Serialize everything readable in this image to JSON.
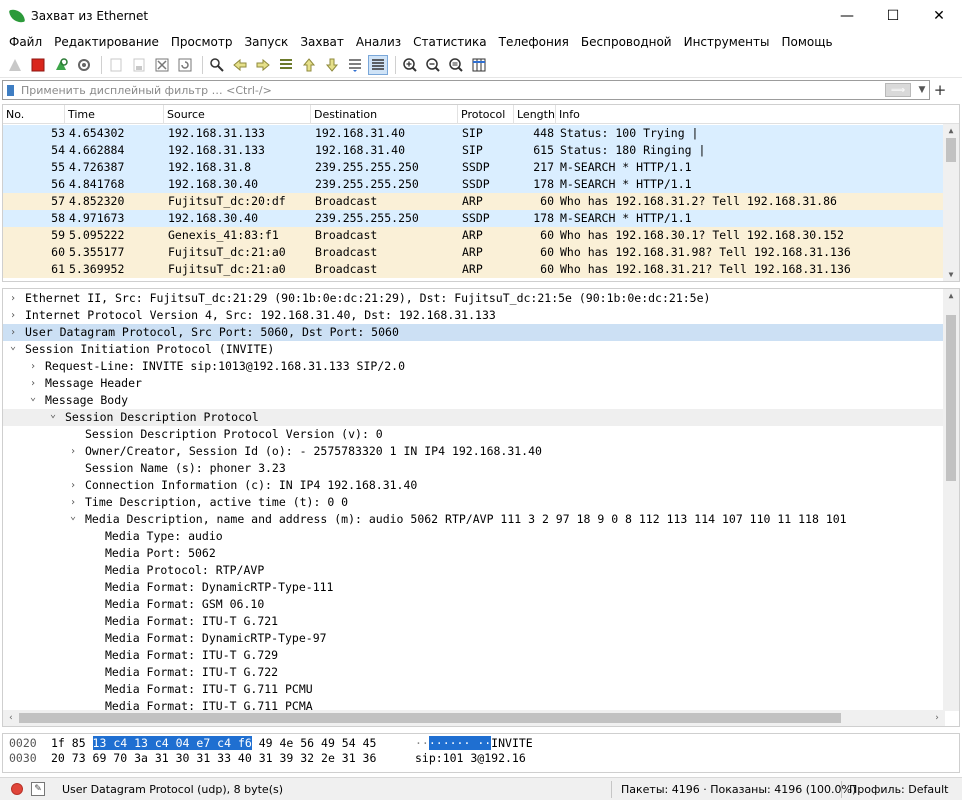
{
  "window": {
    "title": "Захват из Ethernet",
    "minimize": "—",
    "maximize": "☐",
    "close": "✕"
  },
  "menu": [
    "Файл",
    "Редактирование",
    "Просмотр",
    "Запуск",
    "Захват",
    "Анализ",
    "Статистика",
    "Телефония",
    "Беспроводной",
    "Инструменты",
    "Помощь"
  ],
  "filter": {
    "placeholder": "Применить дисплейный фильтр … <Ctrl-/>",
    "value": "",
    "apply": "⟹",
    "dropdown": "▼",
    "add": "+"
  },
  "packet_list": {
    "columns": [
      "No.",
      "Time",
      "Source",
      "Destination",
      "Protocol",
      "Length",
      "Info"
    ],
    "rows": [
      {
        "no": "53",
        "time": "4.654302",
        "src": "192.168.31.133",
        "dst": "192.168.31.40",
        "proto": "SIP",
        "len": "448",
        "info": "Status: 100 Trying |",
        "color": "udp"
      },
      {
        "no": "54",
        "time": "4.662884",
        "src": "192.168.31.133",
        "dst": "192.168.31.40",
        "proto": "SIP",
        "len": "615",
        "info": "Status: 180 Ringing |",
        "color": "udp"
      },
      {
        "no": "55",
        "time": "4.726387",
        "src": "192.168.31.8",
        "dst": "239.255.255.250",
        "proto": "SSDP",
        "len": "217",
        "info": "M-SEARCH * HTTP/1.1",
        "color": "udp"
      },
      {
        "no": "56",
        "time": "4.841768",
        "src": "192.168.30.40",
        "dst": "239.255.255.250",
        "proto": "SSDP",
        "len": "178",
        "info": "M-SEARCH * HTTP/1.1",
        "color": "udp"
      },
      {
        "no": "57",
        "time": "4.852320",
        "src": "FujitsuT_dc:20:df",
        "dst": "Broadcast",
        "proto": "ARP",
        "len": "60",
        "info": "Who has 192.168.31.2? Tell 192.168.31.86",
        "color": "arp"
      },
      {
        "no": "58",
        "time": "4.971673",
        "src": "192.168.30.40",
        "dst": "239.255.255.250",
        "proto": "SSDP",
        "len": "178",
        "info": "M-SEARCH * HTTP/1.1",
        "color": "udp"
      },
      {
        "no": "59",
        "time": "5.095222",
        "src": "Genexis_41:83:f1",
        "dst": "Broadcast",
        "proto": "ARP",
        "len": "60",
        "info": "Who has 192.168.30.1? Tell 192.168.30.152",
        "color": "arp"
      },
      {
        "no": "60",
        "time": "5.355177",
        "src": "FujitsuT_dc:21:a0",
        "dst": "Broadcast",
        "proto": "ARP",
        "len": "60",
        "info": "Who has 192.168.31.98? Tell 192.168.31.136",
        "color": "arp"
      },
      {
        "no": "61",
        "time": "5.369952",
        "src": "FujitsuT_dc:21:a0",
        "dst": "Broadcast",
        "proto": "ARP",
        "len": "60",
        "info": "Who has 192.168.31.21? Tell 192.168.31.136",
        "color": "arp"
      }
    ]
  },
  "details": {
    "rows": [
      {
        "level": 0,
        "arrow": "right",
        "text": "Ethernet II, Src: FujitsuT_dc:21:29 (90:1b:0e:dc:21:29), Dst: FujitsuT_dc:21:5e (90:1b:0e:dc:21:5e)"
      },
      {
        "level": 0,
        "arrow": "right",
        "text": "Internet Protocol Version 4, Src: 192.168.31.40, Dst: 192.168.31.133"
      },
      {
        "level": 0,
        "arrow": "right",
        "text": "User Datagram Protocol, Src Port: 5060, Dst Port: 5060",
        "selected": true
      },
      {
        "level": 0,
        "arrow": "down",
        "text": "Session Initiation Protocol (INVITE)"
      },
      {
        "level": 1,
        "arrow": "right",
        "text": "Request-Line: INVITE sip:1013@192.168.31.133 SIP/2.0"
      },
      {
        "level": 1,
        "arrow": "right",
        "text": "Message Header"
      },
      {
        "level": 1,
        "arrow": "down",
        "text": "Message Body"
      },
      {
        "level": 2,
        "arrow": "down",
        "text": "Session Description Protocol",
        "shade": true
      },
      {
        "level": 3,
        "arrow": "none",
        "text": "Session Description Protocol Version (v): 0"
      },
      {
        "level": 3,
        "arrow": "right",
        "text": "Owner/Creator, Session Id (o): - 2575783320 1 IN IP4 192.168.31.40"
      },
      {
        "level": 3,
        "arrow": "none",
        "text": "Session Name (s): phoner 3.23"
      },
      {
        "level": 3,
        "arrow": "right",
        "text": "Connection Information (c): IN IP4 192.168.31.40"
      },
      {
        "level": 3,
        "arrow": "right",
        "text": "Time Description, active time (t): 0 0"
      },
      {
        "level": 3,
        "arrow": "down",
        "text": "Media Description, name and address (m): audio 5062 RTP/AVP 111 3 2 97 18 9 0 8 112 113 114 107 110 11 118 101"
      },
      {
        "level": 4,
        "arrow": "none",
        "text": "Media Type: audio"
      },
      {
        "level": 4,
        "arrow": "none",
        "text": "Media Port: 5062"
      },
      {
        "level": 4,
        "arrow": "none",
        "text": "Media Protocol: RTP/AVP"
      },
      {
        "level": 4,
        "arrow": "none",
        "text": "Media Format: DynamicRTP-Type-111"
      },
      {
        "level": 4,
        "arrow": "none",
        "text": "Media Format: GSM 06.10"
      },
      {
        "level": 4,
        "arrow": "none",
        "text": "Media Format: ITU-T G.721"
      },
      {
        "level": 4,
        "arrow": "none",
        "text": "Media Format: DynamicRTP-Type-97"
      },
      {
        "level": 4,
        "arrow": "none",
        "text": "Media Format: ITU-T G.729"
      },
      {
        "level": 4,
        "arrow": "none",
        "text": "Media Format: ITU-T G.722"
      },
      {
        "level": 4,
        "arrow": "none",
        "text": "Media Format: ITU-T G.711 PCMU"
      },
      {
        "level": 4,
        "arrow": "none",
        "text": "Media Format: ITU-T G.711 PCMA"
      }
    ]
  },
  "bytes": {
    "rows": [
      {
        "offset": "0020",
        "hex_pre": "1f 85 ",
        "hex_hl": "13 c4 13 c4 04 e7  c4 f6",
        "hex_post": " 49 4e 56 49 54 45",
        "ascii_pre": "··",
        "ascii_hl": "······ ··",
        "ascii_post": "INVITE"
      },
      {
        "offset": "0030",
        "hex_pre": "20 73 69 70 3a 31 30 31  33 40 31 39 32 2e 31 36",
        "hex_hl": "",
        "hex_post": "",
        "ascii_pre": " sip:101 3@192.16",
        "ascii_hl": "",
        "ascii_post": ""
      }
    ]
  },
  "status": {
    "field": "User Datagram Protocol (udp), 8 byte(s)",
    "packets": "Пакеты: 4196 · Показаны: 4196 (100.0%)",
    "profile": "Профиль: Default"
  },
  "colors": {
    "udp_row": "#daeeff",
    "arp_row": "#faf0d7",
    "selection": "#cce0f4",
    "bytes_highlight": "#1f6fd1"
  }
}
